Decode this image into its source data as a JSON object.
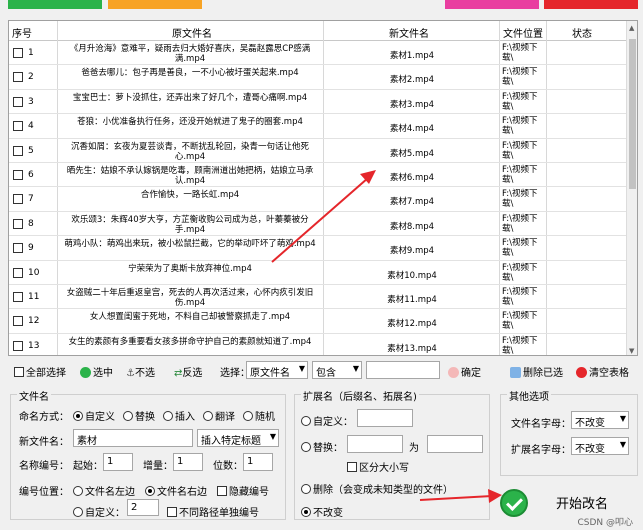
{
  "header": {
    "seq": "序号",
    "orig": "原文件名",
    "new": "新文件名",
    "loc": "文件位置",
    "status": "状态"
  },
  "rows": [
    {
      "no": "1",
      "orig": "《月升沧海》意难平，疑雨去归大婚好喜庆，吴磊赵露思CP感满满.mp4",
      "new": "素材1.mp4",
      "loc": "F:\\视频下载\\"
    },
    {
      "no": "2",
      "orig": "爸爸去哪儿：包子再是善良，一不小心被圩蛋关起来.mp4",
      "new": "素材2.mp4",
      "loc": "F:\\视频下载\\"
    },
    {
      "no": "3",
      "orig": "宝宝巴士：萝卜没抓住，还弄出来了好几个，遭哥心痛啊.mp4",
      "new": "素材3.mp4",
      "loc": "F:\\视频下载\\"
    },
    {
      "no": "4",
      "orig": "苍狼：小优准备执行任务，还没开始就进了鬼子的圈套.mp4",
      "new": "素材4.mp4",
      "loc": "F:\\视频下载\\"
    },
    {
      "no": "5",
      "orig": "沉香如屑：玄夜为夏芸谈青，不断扰乱轮回，染青一句话让他死心.mp4",
      "new": "素材5.mp4",
      "loc": "F:\\视频下载\\"
    },
    {
      "no": "6",
      "orig": "晒先生：姑娘不承认嫁锅是吃毒，顾南洲道出她把柄，姑娘立马承认.mp4",
      "new": "素材6.mp4",
      "loc": "F:\\视频下载\\"
    },
    {
      "no": "7",
      "orig": "合作愉快，一路长虹.mp4",
      "new": "素材7.mp4",
      "loc": "F:\\视频下载\\"
    },
    {
      "no": "8",
      "orig": "欢乐颂3：朱辉40岁大亨，方芷衡收购公司成为总，叶蓁蓁被分手.mp4",
      "new": "素材8.mp4",
      "loc": "F:\\视频下载\\"
    },
    {
      "no": "9",
      "orig": "萌鸡小队：萌鸡出来玩，被小松鼠拦截，它的举动吓坏了萌鸡.mp4",
      "new": "素材9.mp4",
      "loc": "F:\\视频下载\\"
    },
    {
      "no": "10",
      "orig": "宁荣荣为了奥斯卡放弃神位.mp4",
      "new": "素材10.mp4",
      "loc": "F:\\视频下载\\"
    },
    {
      "no": "11",
      "orig": "女盗贼二十年后重返皇宫，死去的人再次活过来，心怀内疚引发旧伤.mp4",
      "new": "素材11.mp4",
      "loc": "F:\\视频下载\\"
    },
    {
      "no": "12",
      "orig": "女人想置闺蜜于死地，不料自己却被警察抓走了.mp4",
      "new": "素材12.mp4",
      "loc": "F:\\视频下载\\"
    },
    {
      "no": "13",
      "orig": "女生的素颜有多重要看女孩多拼命守护自己的素颜就知道了.mp4",
      "new": "素材13.mp4",
      "loc": "F:\\视频下载\\"
    }
  ],
  "toolbar": {
    "select_all": "全部选择",
    "select": "选中",
    "deselect": "不选",
    "invert": "反选",
    "choose_label": "选择：",
    "field_value": "原文件名",
    "match_value": "包含",
    "confirm": "确定",
    "delete_selected": "删除已选",
    "clear_table": "清空表格"
  },
  "filename_group": {
    "title": "文件名",
    "naming_label": "命名方式：",
    "opt_custom": "自定义",
    "opt_replace": "替换",
    "opt_insert": "插入",
    "opt_translate": "翻译",
    "opt_random": "随机",
    "newname_label": "新文件名：",
    "newname_value": "素材",
    "insert_tag": "插入特定标题",
    "numbering_label": "名称编号：",
    "start_label": "起始：",
    "start_value": "1",
    "step_label": "增量：",
    "step_value": "1",
    "digits_label": "位数：",
    "digits_value": "1",
    "position_label": "编号位置：",
    "pos_left": "文件名左边",
    "pos_right": "文件名右边",
    "hide_num": "隐藏编号",
    "pos_custom": "自定义：",
    "custom_value": "2",
    "diff_path": "不同路径单独编号"
  },
  "ext_group": {
    "title": "扩展名（后缀名、拓展名)",
    "custom": "自定义：",
    "replace": "替换：",
    "to": "为",
    "case_sensitive": "区分大小写",
    "delete": "删除（会变成未知类型的文件）",
    "unchanged": "不改变"
  },
  "other_group": {
    "title": "其他选项",
    "filename_case_label": "文件名字母：",
    "filename_case_value": "不改变",
    "ext_case_label": "扩展名字母：",
    "ext_case_value": "不改变"
  },
  "start_button": "开始改名",
  "watermark": "CSDN @叩心"
}
